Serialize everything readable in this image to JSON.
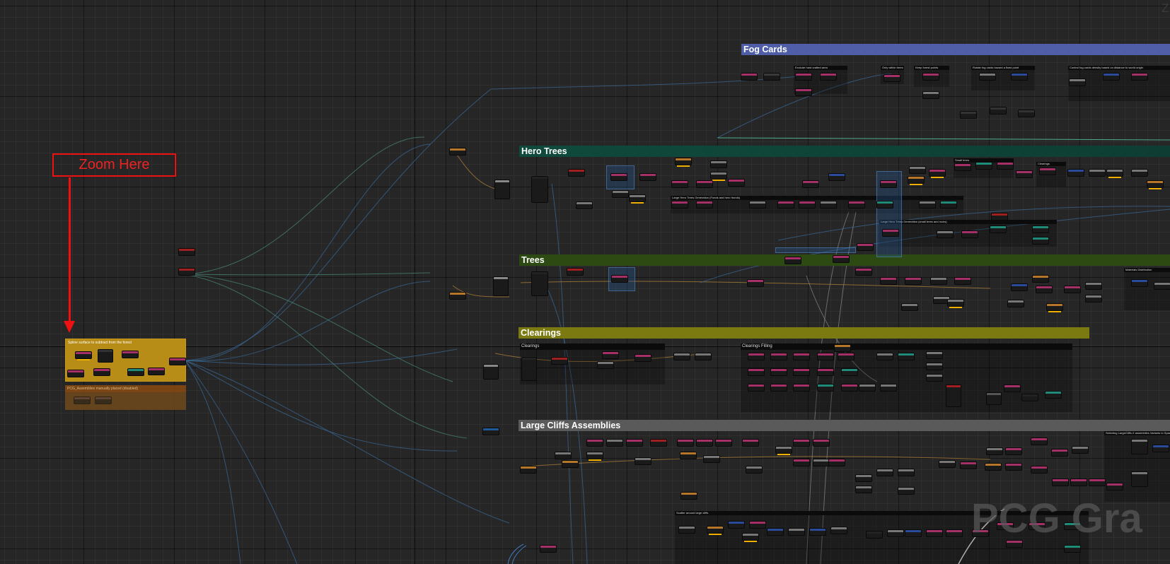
{
  "annotation": {
    "zoom_label": "Zoom Here"
  },
  "groups": {
    "fog_cards": "Fog Cards",
    "hero_trees": "Hero Trees",
    "trees": "Trees",
    "clearings": "Clearings",
    "large_cliffs": "Large Cliffs Assemblies"
  },
  "comments": {
    "spline_surface": "Spline surface to subtract from the forest",
    "pcg_assemblies": "PCG_Assemblies manually placed (disabled)",
    "fog_exclude": "Exclude hard crafted area",
    "fog_only_within": "Only within trees",
    "fog_keep_forest": "Keep forest points",
    "fog_rotate": "Rotate fog cards toward a fixed point",
    "fog_control": "Control fog cards density based on distance to world origin",
    "hero_large_trees_sm": "Large Hero Trees Generation (Fonds and hero fronds)",
    "hero_small_trees": "Large Hero Trees Generation (small trees and rocks)",
    "hero_small": "Small trees",
    "hero_clearings": "Clearings",
    "trees_materials": "Materials Distribution",
    "clearings_sub": "Clearings",
    "clearings_filling": "Clearings Filling",
    "cliffs_scatter": "Scatter around large cliffs",
    "cliffs_select": "Selecting LargeCliffs-X assemblies Variants to Spawn"
  },
  "watermark": "PCG Gra",
  "corner_text": "Z",
  "colors": {
    "background": "#262626",
    "fog_cards": "#4f5ea6",
    "hero_trees": "#0f4a3c",
    "trees": "#2d4a12",
    "clearings": "#7b7a10",
    "large_cliffs": "#5a5a5a",
    "annotation": "#ee1111",
    "spline_group": "#b78d17"
  }
}
